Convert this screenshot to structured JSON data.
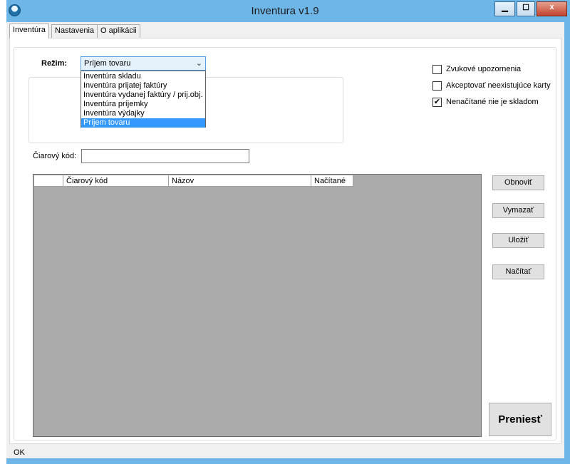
{
  "window": {
    "title": "Inventura v1.9",
    "minimize": "▁",
    "maximize": "☐",
    "close": "x"
  },
  "tabs": [
    "Inventúra",
    "Nastavenia",
    "O aplikácii"
  ],
  "mode": {
    "label": "Režim:",
    "selected": "Príjem tovaru",
    "options": [
      "Inventúra skladu",
      "Inventúra prijatej faktúry",
      "Inventúra vydanej faktúry / prij.obj.",
      "Inventúra príjemky",
      "Inventúra výdajky",
      "Príjem tovaru"
    ]
  },
  "checkboxes": [
    {
      "label": "Zvukové upozornenia",
      "checked": false
    },
    {
      "label": "Akceptovať neexistujúce karty",
      "checked": false
    },
    {
      "label": "Nenačítané nie je skladom",
      "checked": true
    }
  ],
  "barcode": {
    "label": "Čiarový kód:",
    "value": ""
  },
  "grid": {
    "columns": [
      "",
      "Čiarový kód",
      "Názov",
      "Načítané"
    ]
  },
  "buttons": {
    "refresh": "Obnoviť",
    "delete": "Vymazať",
    "save": "Uložiť",
    "load": "Načítať",
    "transfer": "Preniesť"
  },
  "status": "OK"
}
